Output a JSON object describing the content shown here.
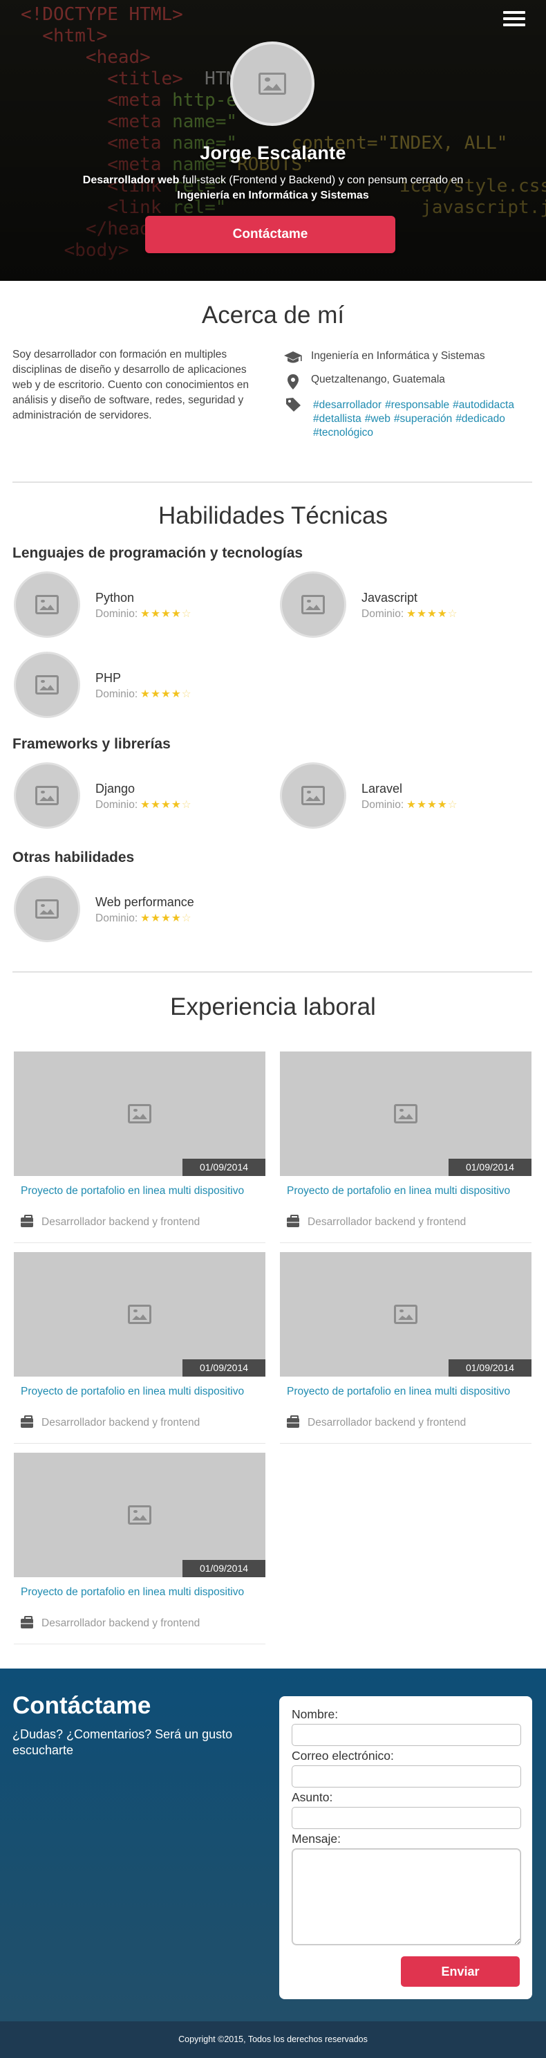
{
  "hero": {
    "name": "Jorge Escalante",
    "desc_bold1": "Desarrollador web",
    "desc_normal": " full-stack (Frontend y Backend) y con pensum cerrado en",
    "desc_bold2": "Ingeniería en Informática y Sistemas",
    "cta_label": "Contáctame",
    "menu_icon": "hamburger-icon",
    "avatar_icon": "image-placeholder-icon"
  },
  "about": {
    "title": "Acerca de mí",
    "text": "Soy desarrollador con formación en multiples disciplinas de diseño y desarrollo de aplicaciones web y de escritorio. Cuento con conocimientos en análisis y diseño de software, redes, seguridad y administración de servidores.",
    "degree": "Ingeniería en Informática y Sistemas",
    "location": "Quetzaltenango, Guatemala",
    "tags": [
      "#desarrollador",
      "#responsable",
      "#autodidacta",
      "#detallista",
      "#web",
      "#superación",
      "#dedicado",
      "#tecnológico"
    ]
  },
  "skills": {
    "title": "Habilidades Técnicas",
    "domain_label": "Dominio:",
    "groups": [
      {
        "title": "Lenguajes de programación y tecnologías",
        "items": [
          {
            "name": "Python",
            "rating": 4,
            "max": 5
          },
          {
            "name": "Javascript",
            "rating": 4,
            "max": 5
          },
          {
            "name": "PHP",
            "rating": 4,
            "max": 5
          }
        ]
      },
      {
        "title": "Frameworks y librerías",
        "items": [
          {
            "name": "Django",
            "rating": 4,
            "max": 5
          },
          {
            "name": "Laravel",
            "rating": 4,
            "max": 5
          }
        ]
      },
      {
        "title": "Otras habilidades",
        "items": [
          {
            "name": "Web performance",
            "rating": 4,
            "max": 5
          }
        ]
      }
    ]
  },
  "experience": {
    "title": "Experiencia laboral",
    "jobs": [
      {
        "date": "01/09/2014",
        "title": "Proyecto de portafolio en linea multi dispositivo",
        "role": "Desarrollador backend y frontend"
      },
      {
        "date": "01/09/2014",
        "title": "Proyecto de portafolio en linea multi dispositivo",
        "role": "Desarrollador backend y frontend"
      },
      {
        "date": "01/09/2014",
        "title": "Proyecto de portafolio en linea multi dispositivo",
        "role": "Desarrollador backend y frontend"
      },
      {
        "date": "01/09/2014",
        "title": "Proyecto de portafolio en linea multi dispositivo",
        "role": "Desarrollador backend y frontend"
      },
      {
        "date": "01/09/2014",
        "title": "Proyecto de portafolio en linea multi dispositivo",
        "role": "Desarrollador backend y frontend"
      }
    ]
  },
  "contact": {
    "title": "Contáctame",
    "subtitle": "¿Dudas? ¿Comentarios? Será un gusto escucharte",
    "name_label": "Nombre:",
    "email_label": "Correo electrónico:",
    "subject_label": "Asunto:",
    "message_label": "Mensaje:",
    "name_value": "",
    "email_value": "",
    "subject_value": "",
    "message_value": "",
    "send_label": "Enviar"
  },
  "footer": {
    "copyright": "Copyright ©2015, Todos los derechos reservados"
  },
  "colors": {
    "accent": "#e0344f",
    "link": "#1f8bb0",
    "star": "#f2c21f",
    "contact_bg": "#0e4e77",
    "footer_bg": "#1e3a52"
  }
}
